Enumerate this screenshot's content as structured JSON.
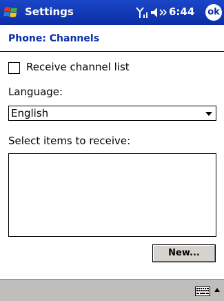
{
  "titlebar": {
    "title": "Settings",
    "time": "6:44",
    "ok_label": "ok",
    "icons": [
      "windows-logo-icon",
      "signal-icon",
      "speaker-icon"
    ]
  },
  "page": {
    "heading": "Phone: Channels"
  },
  "form": {
    "receive_checkbox_label": "Receive channel list",
    "receive_checked": false,
    "language_label": "Language:",
    "language_value": "English",
    "items_label": "Select items to receive:",
    "new_button_label": "New..."
  },
  "bottombar": {
    "icons": [
      "keyboard-icon",
      "input-menu-arrow-icon"
    ]
  },
  "colors": {
    "titlebar": "#0a2ea5",
    "heading": "#0a2ea5",
    "bottombar": "#c0bebc"
  }
}
